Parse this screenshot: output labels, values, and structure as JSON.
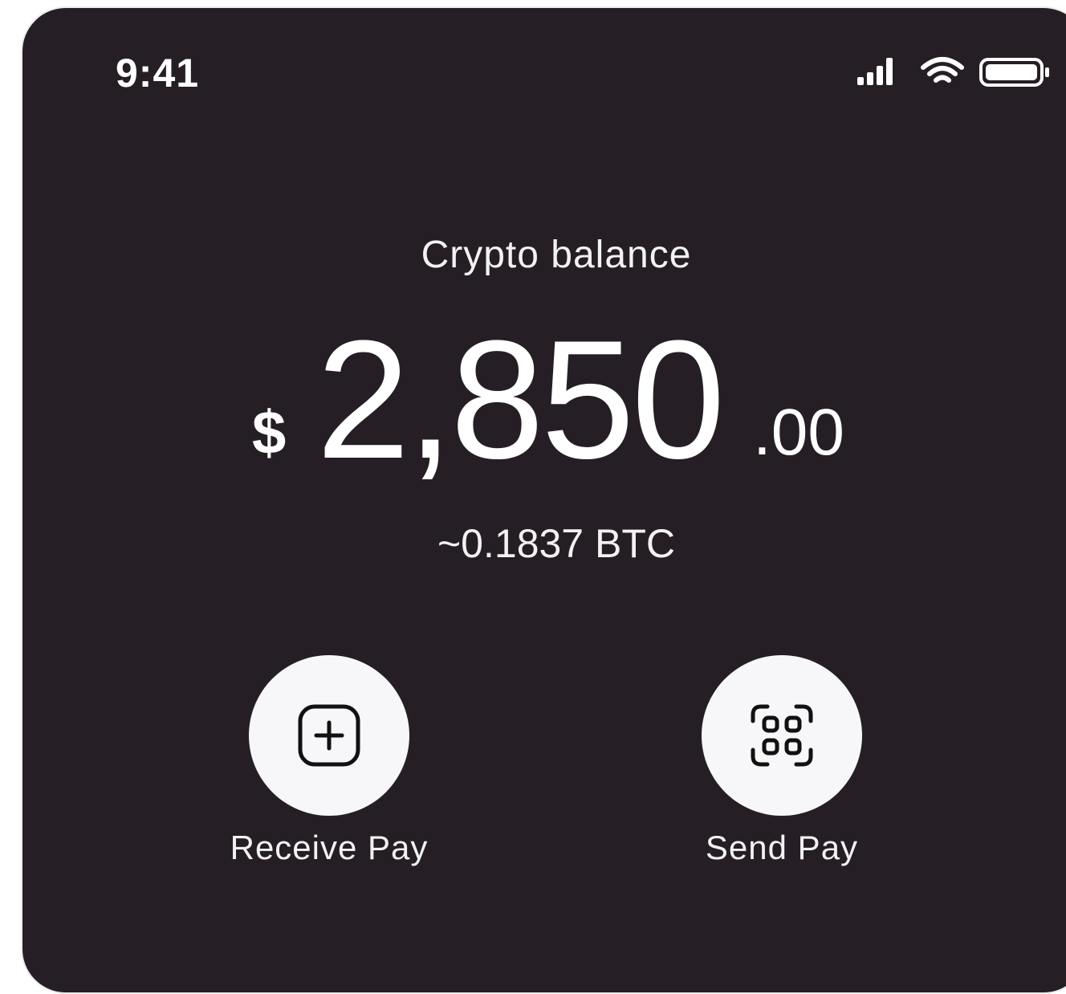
{
  "status_bar": {
    "time": "9:41"
  },
  "balance": {
    "label": "Crypto balance",
    "currency_symbol": "$",
    "amount_main": "2,850",
    "amount_cents": ".00",
    "btc_equivalent": "~0.1837 BTC"
  },
  "actions": [
    {
      "label": "Receive Pay",
      "icon": "plus-square-icon"
    },
    {
      "label": "Send Pay",
      "icon": "qr-scan-icon"
    }
  ],
  "colors": {
    "background": "#251f25",
    "text": "#ffffff",
    "button_bg": "#f7f6f8",
    "icon": "#111111"
  }
}
